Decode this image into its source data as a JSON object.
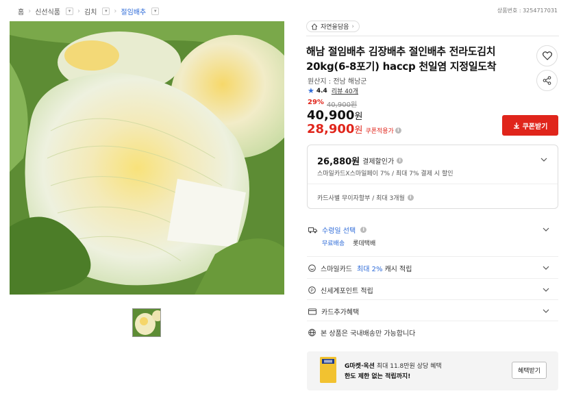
{
  "breadcrumb": [
    {
      "label": "홈"
    },
    {
      "label": "신선식품"
    },
    {
      "label": "김치"
    },
    {
      "label": "절임배추"
    }
  ],
  "product_no": "상품번호 : 3254717031",
  "store": {
    "name": "자연을담음"
  },
  "product": {
    "title": "해남 절임배추 김장배추 절인배추 전라도김치 20kg(6-8포기) haccp 천일염 지정일도착",
    "origin": "원산지 : 전남 해남군",
    "rating": "4.4",
    "reviews": "리뷰 40개",
    "discount_pct": "29%",
    "original_price": "40,900원",
    "price_num": "40,900",
    "price_unit": "원",
    "coupon_price_num": "28,900",
    "coupon_price_unit": "원",
    "coupon_tag": "쿠폰적용가",
    "coupon_button": "쿠폰받기"
  },
  "payment_benefit": {
    "price": "26,880원",
    "label": "결제할인가",
    "detail": "스마일카드X스마일페이 7% / 최대 7% 결제 시 할인",
    "installment": "카드사별 무이자할부 / 최대 3개월"
  },
  "shipping": {
    "label": "수령일 선택",
    "free": "무료배송",
    "courier": "롯데택배"
  },
  "smile_card": {
    "prefix": "스마일카드",
    "highlight": "최대 2%",
    "suffix": "캐시 적립"
  },
  "shinsegae": {
    "label": "신세계포인트 적립"
  },
  "card_extra": {
    "label": "카드추가혜택"
  },
  "domestic": {
    "label": "본 상품은 국내배송만 가능합니다"
  },
  "promo": {
    "line1_bold": "G마켓·옥션",
    "line1_rest": "최대 11.8만원 상당 혜택",
    "line2": "한도 제한 없는 적립까지!",
    "button": "혜택받기"
  },
  "colors": {
    "accent_red": "#e0251b",
    "link_blue": "#2e6bd8"
  }
}
